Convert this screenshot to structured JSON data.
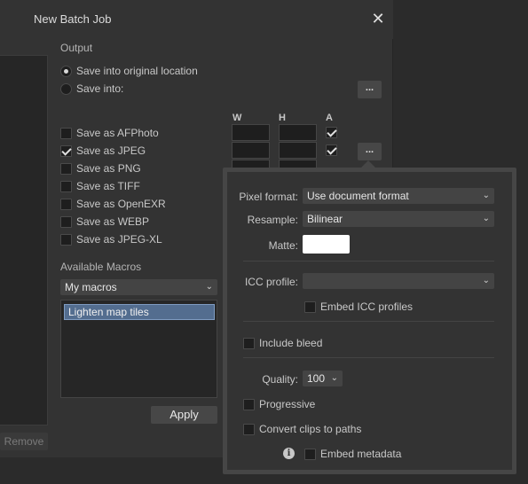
{
  "window": {
    "title": "New Batch Job",
    "close_glyph": "✕"
  },
  "left": {
    "remove_label": "Remove"
  },
  "output": {
    "section_label": "Output",
    "save_original_label": "Save into original location",
    "save_into_label": "Save into:",
    "browse_label": "...",
    "columns": {
      "w": "W",
      "h": "H",
      "a": "A"
    },
    "formats": [
      {
        "label": "Save as AFPhoto",
        "checked": false
      },
      {
        "label": "Save as JPEG",
        "checked": true
      },
      {
        "label": "Save as PNG",
        "checked": false
      },
      {
        "label": "Save as TIFF",
        "checked": false
      },
      {
        "label": "Save as OpenEXR",
        "checked": false
      },
      {
        "label": "Save as WEBP",
        "checked": false
      },
      {
        "label": "Save as JPEG-XL",
        "checked": false
      }
    ],
    "format_options_label": "..."
  },
  "macros": {
    "section_label": "Available Macros",
    "selected_set": "My macros",
    "items": [
      "Lighten map tiles"
    ],
    "apply_label": "Apply"
  },
  "popover": {
    "pixel_format_label": "Pixel format:",
    "pixel_format_value": "Use document format",
    "resample_label": "Resample:",
    "resample_value": "Bilinear",
    "matte_label": "Matte:",
    "icc_label": "ICC profile:",
    "icc_value": "",
    "embed_icc_label": "Embed ICC profiles",
    "include_bleed_label": "Include bleed",
    "quality_label": "Quality:",
    "quality_value": "100",
    "progressive_label": "Progressive",
    "convert_clips_label": "Convert clips to paths",
    "embed_metadata_label": "Embed metadata",
    "info_glyph": "i"
  },
  "colors": {
    "selection": "#536d8f",
    "matte": "#ffffff"
  },
  "icons": {
    "close": "close-icon",
    "chevron": "chevron-down-icon",
    "info": "info-icon"
  }
}
